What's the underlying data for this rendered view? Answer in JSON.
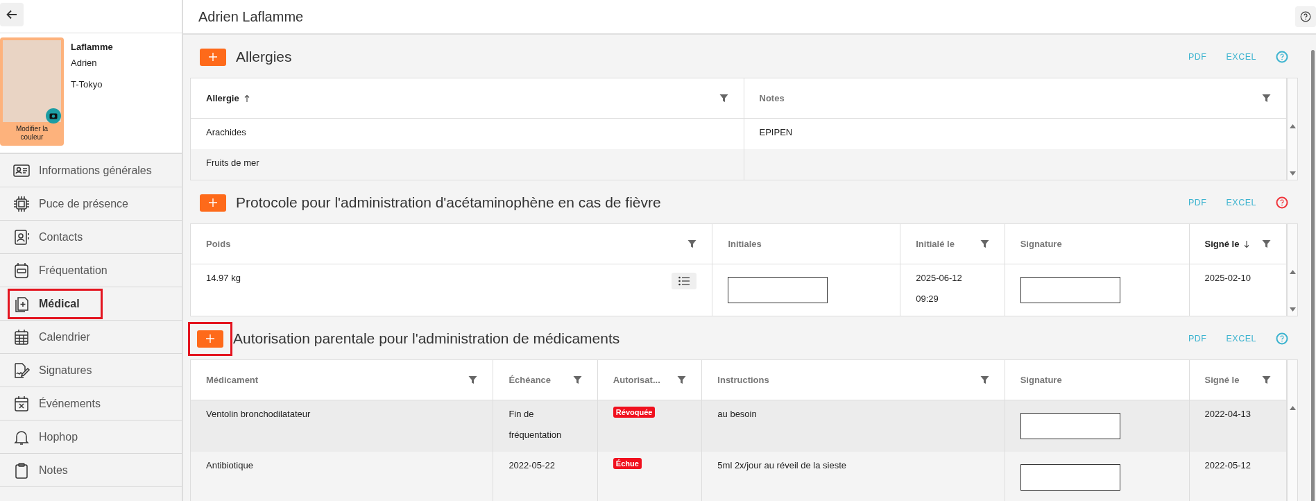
{
  "profile": {
    "last_name": "Laflamme",
    "first_name": "Adrien",
    "group": "T-Tokyo",
    "color_label": "Modifier la couleur"
  },
  "nav": [
    {
      "label": "Informations générales",
      "selected": false,
      "highlighted": false
    },
    {
      "label": "Puce de présence",
      "selected": false,
      "highlighted": false
    },
    {
      "label": "Contacts",
      "selected": false,
      "highlighted": false
    },
    {
      "label": "Fréquentation",
      "selected": false,
      "highlighted": false
    },
    {
      "label": "Médical",
      "selected": true,
      "highlighted": true
    },
    {
      "label": "Calendrier",
      "selected": false,
      "highlighted": false
    },
    {
      "label": "Signatures",
      "selected": false,
      "highlighted": false
    },
    {
      "label": "Événements",
      "selected": false,
      "highlighted": false
    },
    {
      "label": "Hophop",
      "selected": false,
      "highlighted": false
    },
    {
      "label": "Notes",
      "selected": false,
      "highlighted": false
    }
  ],
  "header": {
    "title": "Adrien Laflamme"
  },
  "sections": [
    {
      "title": "Allergies",
      "add_highlighted": false,
      "links": [
        "PDF",
        "EXCEL"
      ],
      "help_icon": {
        "color": "#3bb3cf"
      },
      "columns": [
        {
          "label": "Allergie",
          "sort_ascending": true,
          "sort_descending": false,
          "filter": true
        },
        {
          "label": "Notes",
          "sort_ascending": false,
          "sort_descending": false,
          "filter": true
        }
      ],
      "rows": [
        [
          {
            "kind": "text",
            "text": "Arachides"
          },
          {
            "kind": "text",
            "text": "EPIPEN"
          }
        ],
        [
          {
            "kind": "text",
            "text": "Fruits de mer"
          },
          {
            "kind": "empty"
          }
        ]
      ]
    },
    {
      "title": "Protocole pour l'administration d'acétaminophène en cas de fièvre",
      "add_highlighted": false,
      "links": [
        "PDF",
        "EXCEL"
      ],
      "help_icon": {
        "color": "#f0353b"
      },
      "columns": [
        {
          "label": "Poids",
          "sort_ascending": false,
          "sort_descending": false,
          "filter": true
        },
        {
          "label": "Initiales",
          "sort_ascending": false,
          "sort_descending": false,
          "filter": false
        },
        {
          "label": "Initialé le",
          "sort_ascending": false,
          "sort_descending": false,
          "filter": true
        },
        {
          "label": "Signature",
          "sort_ascending": false,
          "sort_descending": false,
          "filter": false
        },
        {
          "label": "Signé le",
          "sort_ascending": false,
          "sort_descending": true,
          "filter": true
        }
      ],
      "rows": [
        [
          {
            "kind": "list",
            "text": "14.97 kg"
          },
          {
            "kind": "signature"
          },
          {
            "kind": "lines",
            "lines": [
              "2025-06-12",
              "09:29"
            ]
          },
          {
            "kind": "signature"
          },
          {
            "kind": "text",
            "text": "2025-02-10"
          }
        ]
      ]
    },
    {
      "title": "Autorisation parentale pour l'administration de médicaments",
      "add_highlighted": true,
      "links": [
        "PDF",
        "EXCEL"
      ],
      "help_icon": {
        "color": "#3bb3cf"
      },
      "columns": [
        {
          "label": "Médicament",
          "sort_ascending": false,
          "sort_descending": false,
          "filter": true
        },
        {
          "label": "Échéance",
          "sort_ascending": false,
          "sort_descending": false,
          "filter": true
        },
        {
          "label": "Autorisat...",
          "sort_ascending": false,
          "sort_descending": false,
          "filter": true
        },
        {
          "label": "Instructions",
          "sort_ascending": false,
          "sort_descending": false,
          "filter": true
        },
        {
          "label": "Signature",
          "sort_ascending": false,
          "sort_descending": false,
          "filter": false
        },
        {
          "label": "Signé le",
          "sort_ascending": false,
          "sort_descending": false,
          "filter": true
        }
      ],
      "rows": [
        [
          {
            "kind": "text",
            "text": "Ventolin bronchodilatateur"
          },
          {
            "kind": "lines",
            "lines": [
              "Fin de",
              "fréquentation"
            ]
          },
          {
            "kind": "badge",
            "text": "Révoquée",
            "color": "#f0101e"
          },
          {
            "kind": "text",
            "text": "au besoin"
          },
          {
            "kind": "signature"
          },
          {
            "kind": "text",
            "text": "2022-04-13"
          }
        ],
        [
          {
            "kind": "text",
            "text": "Antibiotique"
          },
          {
            "kind": "text",
            "text": "2022-05-22"
          },
          {
            "kind": "badge",
            "text": "Échue",
            "color": "#f0101e"
          },
          {
            "kind": "text",
            "text": "5ml 2x/jour au réveil de la sieste"
          },
          {
            "kind": "signature"
          },
          {
            "kind": "text",
            "text": "2022-05-12"
          }
        ]
      ]
    }
  ]
}
